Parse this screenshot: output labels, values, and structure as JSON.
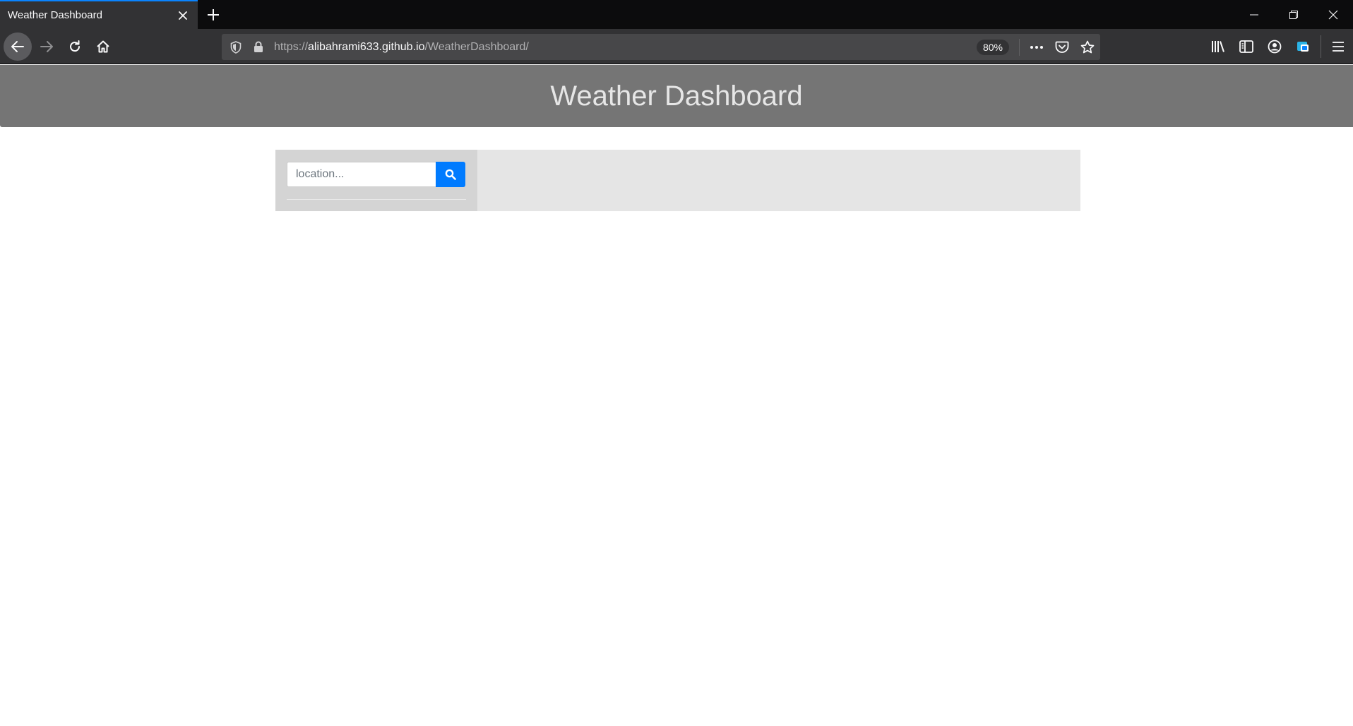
{
  "browser": {
    "tab": {
      "title": "Weather Dashboard"
    },
    "url": {
      "scheme": "https://",
      "host": "alibahrami633.github.io",
      "path": "/WeatherDashboard/"
    },
    "zoom": "80%"
  },
  "page": {
    "header": {
      "title": "Weather Dashboard"
    },
    "search": {
      "placeholder": "location...",
      "value": ""
    }
  },
  "colors": {
    "header_bg": "#757575",
    "search_button": "#007bff",
    "sidebar_bg": "#d4d4d4",
    "main_bg": "#e5e5e5"
  },
  "icons": {
    "close": "close-icon",
    "new_tab": "plus-icon",
    "back": "back-arrow-icon",
    "forward": "forward-arrow-icon",
    "reload": "reload-icon",
    "home": "home-icon",
    "shield": "shield-icon",
    "lock": "lock-icon",
    "more": "more-icon",
    "pocket": "pocket-icon",
    "bookmark": "star-icon",
    "library": "library-icon",
    "sidebar": "sidebar-icon",
    "account": "account-icon",
    "extension": "extension-icon",
    "menu": "hamburger-menu-icon",
    "search": "search-icon"
  }
}
